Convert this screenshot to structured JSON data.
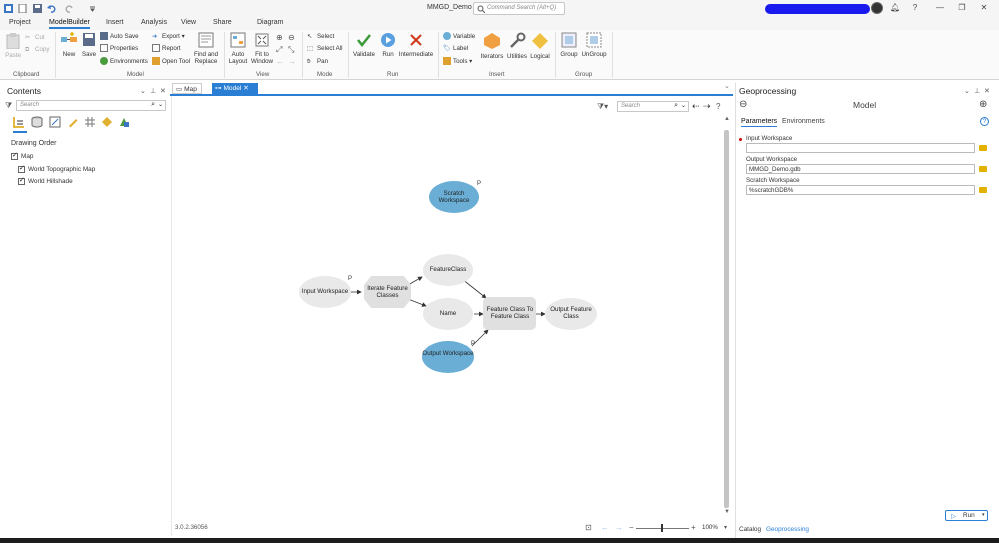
{
  "app": {
    "title": "MMGD_Demo"
  },
  "command_search": {
    "placeholder": "Command Search (Alt+Q)"
  },
  "ribbon_tabs": [
    "Project",
    "ModelBuilder",
    "Insert",
    "Analysis",
    "View",
    "Share",
    "Diagram"
  ],
  "active_ribbon_tab": "ModelBuilder",
  "ribbon": {
    "clipboard": {
      "paste": "Paste",
      "cut": "Cut",
      "copy": "Copy",
      "label": "Clipboard"
    },
    "model": {
      "new": "New",
      "save": "Save",
      "auto_save": "Auto Save",
      "properties": "Properties",
      "environments": "Environments",
      "export": "Export",
      "report": "Report",
      "open_tool": "Open Tool",
      "find_replace": "Find and Replace",
      "label": "Model"
    },
    "view": {
      "auto_layout": "Auto Layout",
      "fit_to_window": "Fit to Window",
      "label": "View"
    },
    "mode": {
      "select": "Select",
      "select_all": "Select All",
      "pan": "Pan",
      "label": "Mode"
    },
    "run": {
      "validate": "Validate",
      "run": "Run",
      "intermediate": "Intermediate",
      "label": "Run"
    },
    "insert": {
      "variable": "Variable",
      "label_btn": "Label",
      "tools": "Tools",
      "iterators": "Iterators",
      "utilities": "Utilities",
      "logical": "Logical",
      "label": "Insert"
    },
    "group": {
      "group": "Group",
      "ungroup": "UnGroup",
      "label": "Group"
    }
  },
  "contents": {
    "title": "Contents",
    "search_placeholder": "Search",
    "drawing_order": "Drawing Order",
    "layers": [
      {
        "name": "Map",
        "checked": true
      },
      {
        "name": "World Topographic Map",
        "checked": true
      },
      {
        "name": "World Hillshade",
        "checked": true
      }
    ]
  },
  "view_tabs": [
    "Map",
    "Model"
  ],
  "active_view_tab": "Model",
  "canvas": {
    "search_placeholder": "Search",
    "nodes": {
      "scratch_workspace": "Scratch Workspace",
      "input_workspace": "Input Workspace",
      "iterate_fc": "Iterate Feature Classes",
      "featureclass": "FeatureClass",
      "name": "Name",
      "fc_to_fc": "Feature Class To Feature Class",
      "output_fc": "Output Feature Class",
      "output_workspace": "Output Workspace"
    },
    "parameter_marker": "P",
    "colors": {
      "param_fill": "#6aaed6",
      "var_fill": "#e9e9e9",
      "tool_fill": "#e0e0e0"
    }
  },
  "status": {
    "version": "3.0.2.36056",
    "zoom": "100%"
  },
  "geoprocessing": {
    "title": "Geoprocessing",
    "tool_name": "Model",
    "tabs": [
      "Parameters",
      "Environments"
    ],
    "active_tab": "Parameters",
    "params": [
      {
        "label": "Input Workspace",
        "value": "",
        "required": true
      },
      {
        "label": "Output Workspace",
        "value": "MMGD_Demo.gdb",
        "required": false
      },
      {
        "label": "Scratch Workspace",
        "value": "%scratchGDB%",
        "required": false
      }
    ],
    "run_label": "Run"
  },
  "bottom_tabs": [
    "Catalog",
    "Geoprocessing"
  ],
  "active_bottom_tab": "Geoprocessing",
  "accent_color": "#2a7fd4"
}
